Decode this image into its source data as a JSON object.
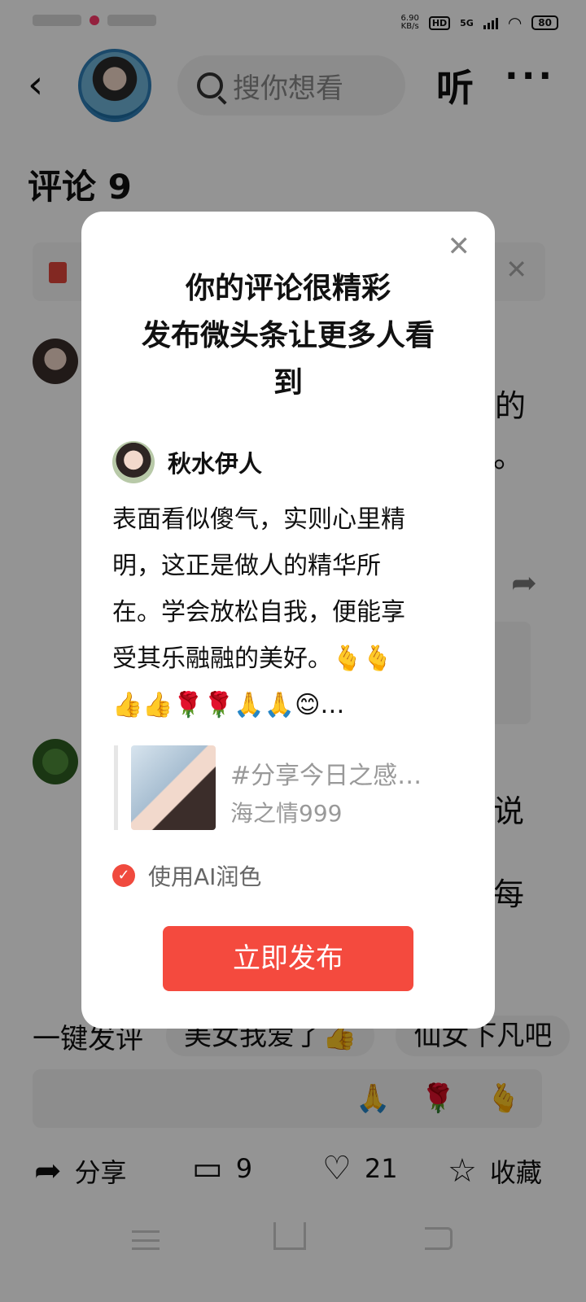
{
  "status_bar": {
    "net_speed": "6.90",
    "net_unit": "KB/s",
    "hd": "HD",
    "network": "5G",
    "battery": "80"
  },
  "top_nav": {
    "search_placeholder": "搜你想看",
    "listen": "听",
    "more": "···"
  },
  "comments": {
    "title": "评论 9",
    "frag_1": "的",
    "frag_2": "。",
    "frag_3": "说",
    "frag_4": "每"
  },
  "quick_replies": {
    "one_tap": "一键发评",
    "chip_1": "美女我爱了👍",
    "chip_2": "仙女下凡吧"
  },
  "input_bar": {
    "emoji_1": "🙏",
    "emoji_2": "🌹",
    "emoji_3": "🫰"
  },
  "bottom_bar": {
    "share_label": "分享",
    "comment_count": "9",
    "like_count": "21",
    "favorite_label": "收藏"
  },
  "modal": {
    "close": "✕",
    "title_line1": "你的评论很精彩",
    "title_line2": "发布微头条让更多人看",
    "title_line3": "到",
    "author_name": "秋水伊人",
    "comment_line1": "表面看似傻气，实则心里精",
    "comment_line2": "明，这正是做人的精华所",
    "comment_line3": "在。学会放松自我，便能享",
    "comment_line4": "受其乐融融的美好。🫰🫰",
    "comment_line5": "👍👍🌹🌹🙏🙏😊…",
    "quote_title": "#分享今日之感…",
    "quote_author": "海之情999",
    "ai_polish_label": "使用AI润色",
    "publish_button": "立即发布"
  }
}
